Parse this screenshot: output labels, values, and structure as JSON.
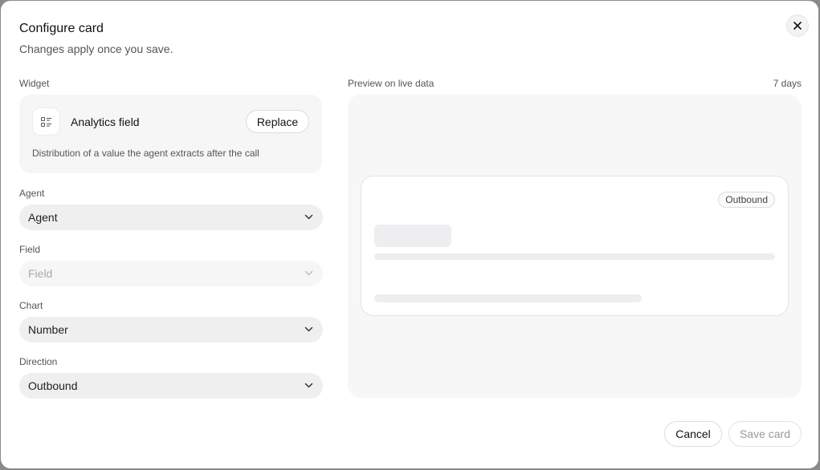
{
  "dialog": {
    "title": "Configure card",
    "subtitle": "Changes apply once you save.",
    "close_icon": "close-icon"
  },
  "widget": {
    "section_label": "Widget",
    "icon": "list-icon",
    "name": "Analytics field",
    "replace_label": "Replace",
    "description": "Distribution of a value the agent extracts after the call"
  },
  "fields": {
    "agent": {
      "label": "Agent",
      "value": "Agent",
      "disabled": false
    },
    "field": {
      "label": "Field",
      "value": "Field",
      "disabled": true
    },
    "chart": {
      "label": "Chart",
      "value": "Number",
      "disabled": false
    },
    "direction": {
      "label": "Direction",
      "value": "Outbound",
      "disabled": false
    }
  },
  "preview": {
    "label": "Preview on live data",
    "range": "7 days",
    "badge": "Outbound"
  },
  "footer": {
    "cancel_label": "Cancel",
    "save_label": "Save card"
  },
  "colors": {
    "overlay": "#8a8a8a",
    "surface": "#ffffff",
    "field_bg": "#efefef",
    "muted_text": "#555555",
    "disabled_text": "#aaaaaa"
  }
}
